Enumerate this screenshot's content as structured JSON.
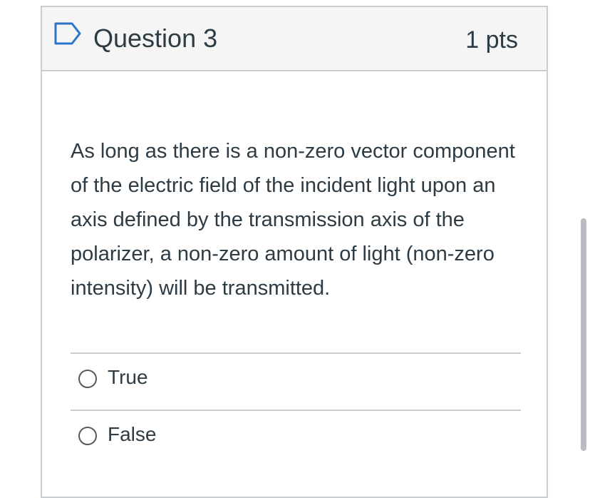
{
  "question": {
    "title": "Question 3",
    "points": "1 pts",
    "text": "As long as there is a non-zero vector component of the electric field of the incident light upon an axis defined by the transmission axis of the polarizer, a non-zero amount of light (non-zero intensity) will be transmitted."
  },
  "answers": [
    {
      "label": "True",
      "selected": false
    },
    {
      "label": "False",
      "selected": false
    }
  ],
  "icons": {
    "flag": "flag-icon",
    "radio": "radio-icon"
  },
  "colors": {
    "accent": "#2b74c9",
    "text": "#2d3b45",
    "border": "#c7cdd1",
    "header_bg": "#f5f5f5"
  }
}
